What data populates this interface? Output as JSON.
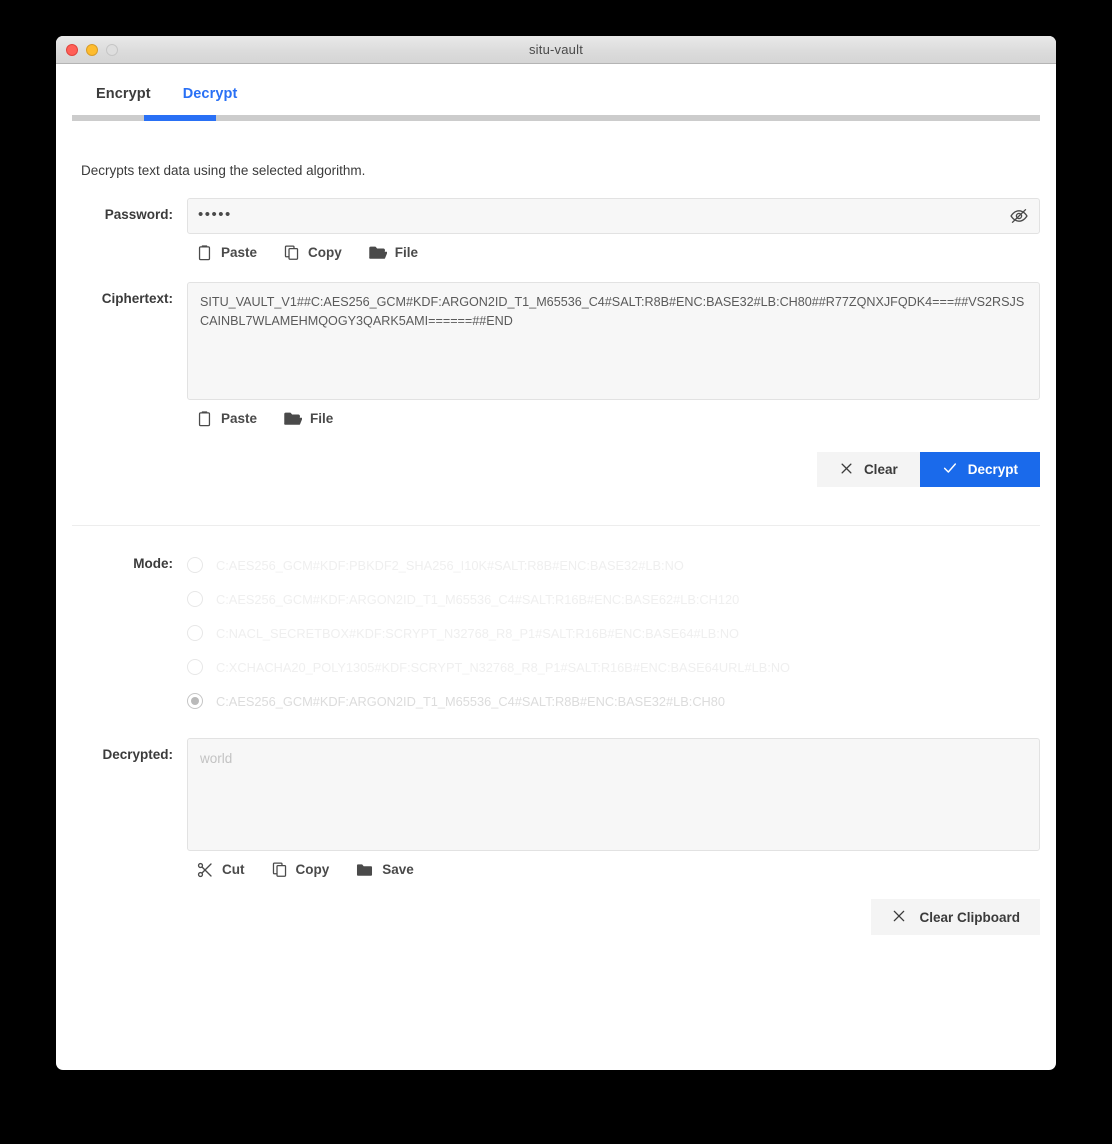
{
  "window": {
    "title": "situ-vault",
    "traffic_lights": [
      "close-red",
      "minimize-yellow",
      "zoom-gray"
    ]
  },
  "tabs": [
    {
      "label": "Encrypt",
      "active": false
    },
    {
      "label": "Decrypt",
      "active": true
    }
  ],
  "description": "Decrypts text data using the selected algorithm.",
  "password": {
    "label": "Password:",
    "value": "•••••",
    "placeholder": "",
    "toggle_icon": "eye-off-icon"
  },
  "password_actions": [
    {
      "label": "Paste",
      "icon": "clipboard-icon"
    },
    {
      "label": "Copy",
      "icon": "copy-icon"
    },
    {
      "label": "File",
      "icon": "folder-open-icon"
    }
  ],
  "ciphertext": {
    "label": "Ciphertext:",
    "value": "SITU_VAULT_V1##C:AES256_GCM#KDF:ARGON2ID_T1_M65536_C4#SALT:R8B#ENC:BASE32#LB:CH80##R77ZQNXJFQDK4===##VS2RSJSCAINBL7WLAMEHMQOGY3QARK5AMI======##END"
  },
  "ciphertext_actions": [
    {
      "label": "Paste",
      "icon": "clipboard-icon"
    },
    {
      "label": "File",
      "icon": "folder-open-icon"
    }
  ],
  "main_actions": {
    "clear": {
      "label": "Clear",
      "icon": "x-icon"
    },
    "decrypt": {
      "label": "Decrypt",
      "icon": "check-icon"
    }
  },
  "mode": {
    "label": "Mode:",
    "options": [
      {
        "label": "C:AES256_GCM#KDF:PBKDF2_SHA256_I10K#SALT:R8B#ENC:BASE32#LB:NO",
        "selected": false
      },
      {
        "label": "C:AES256_GCM#KDF:ARGON2ID_T1_M65536_C4#SALT:R16B#ENC:BASE62#LB:CH120",
        "selected": false
      },
      {
        "label": "C:NACL_SECRETBOX#KDF:SCRYPT_N32768_R8_P1#SALT:R16B#ENC:BASE64#LB:NO",
        "selected": false
      },
      {
        "label": "C:XCHACHA20_POLY1305#KDF:SCRYPT_N32768_R8_P1#SALT:R16B#ENC:BASE64URL#LB:NO",
        "selected": false
      },
      {
        "label": "C:AES256_GCM#KDF:ARGON2ID_T1_M65536_C4#SALT:R8B#ENC:BASE32#LB:CH80",
        "selected": true
      }
    ]
  },
  "decrypted": {
    "label": "Decrypted:",
    "value": "world"
  },
  "decrypted_actions": [
    {
      "label": "Cut",
      "icon": "scissors-icon"
    },
    {
      "label": "Copy",
      "icon": "copy-icon"
    },
    {
      "label": "Save",
      "icon": "folder-filled-icon"
    }
  ],
  "clipboard_action": {
    "label": "Clear Clipboard",
    "icon": "x-icon"
  },
  "colors": {
    "accent": "#2970f5",
    "primary_button": "#1a6aeb",
    "desktop": "#000000",
    "field_bg": "#f7f7f7"
  }
}
